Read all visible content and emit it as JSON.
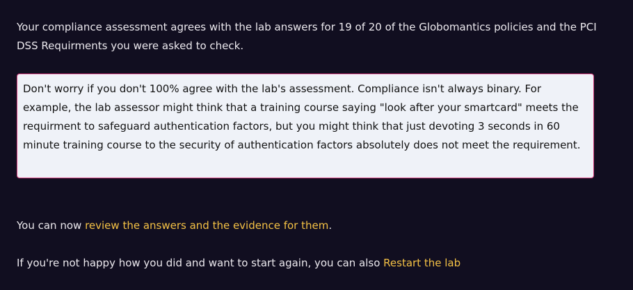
{
  "summary": {
    "text": "Your compliance assessment agrees with the lab answers for 19 of 20 of the Globomantics policies and the PCI DSS Requirments you were asked to check."
  },
  "notice": {
    "text": "Don't worry if you don't 100% agree with the lab's assessment. Compliance isn't always binary. For example, the lab assessor might think that a training course saying \"look after your smartcard\" meets the requirment to safeguard authentication factors, but you might think that just devoting 3 seconds in 60 minute training course to the security of authentication factors absolutely does not meet the requirement."
  },
  "review": {
    "prefix": "You can now ",
    "link_label": "review the answers and the evidence for them",
    "suffix": "."
  },
  "restart": {
    "prefix": "If you're not happy how you did and want to start again, you can also ",
    "link_label": "Restart the lab"
  },
  "colors": {
    "background": "#110e20",
    "text": "#ece9ee",
    "link": "#f4c145",
    "notice_background": "#eff2f8",
    "notice_border": "#d63d7d"
  }
}
